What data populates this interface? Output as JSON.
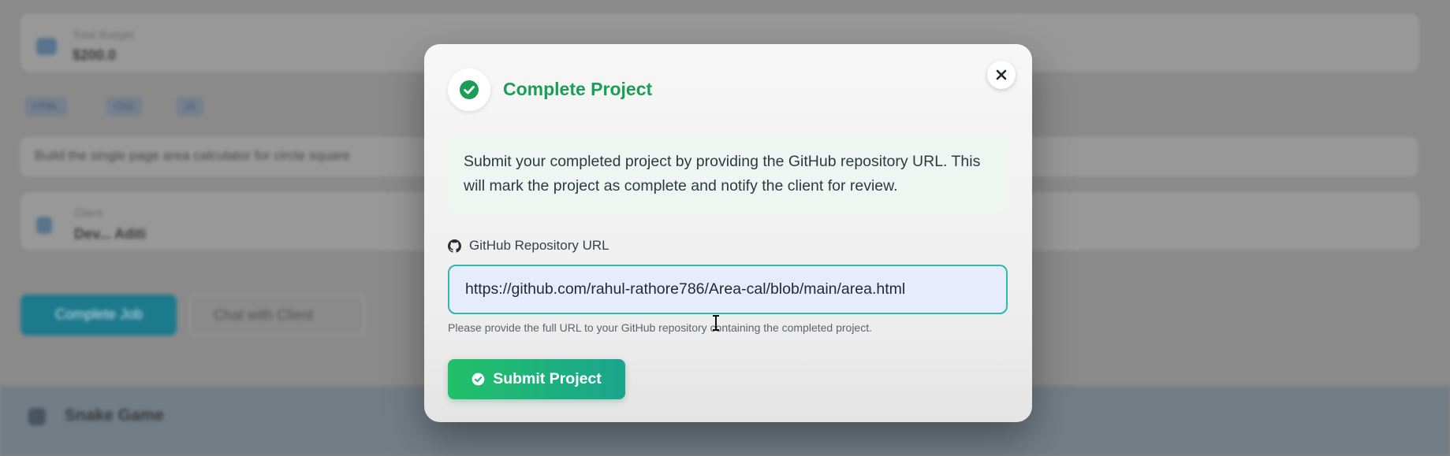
{
  "background": {
    "budget_label": "Total Budget",
    "budget_value": "$200.0",
    "tags": [
      "HTML",
      "CSS",
      "JS"
    ],
    "description": "Build the single page area calculator for circle square",
    "client_label": "Client",
    "client_value": "Dev... Aditi",
    "complete_job_button": "Complete Job",
    "chat_button": "Chat with Client",
    "next_project_title": "Snake Game"
  },
  "modal": {
    "title": "Complete Project",
    "info_text": "Submit your completed project by providing the GitHub repository URL. This will mark the project as complete and notify the client for review.",
    "field_label": "GitHub Repository URL",
    "url_value": "https://github.com/rahul-rathore786/Area-cal/blob/main/area.html",
    "helper_text": "Please provide the full URL to your GitHub repository containing the completed project.",
    "submit_label": "Submit Project"
  },
  "colors": {
    "accent_green": "#1a9e56",
    "input_border": "#30b8b0",
    "submit_gradient_start": "#22c068",
    "submit_gradient_end": "#1aa58e"
  },
  "icons": {
    "header": "check-circle-icon",
    "close": "close-icon",
    "field": "github-icon",
    "submit": "check-circle-icon"
  }
}
